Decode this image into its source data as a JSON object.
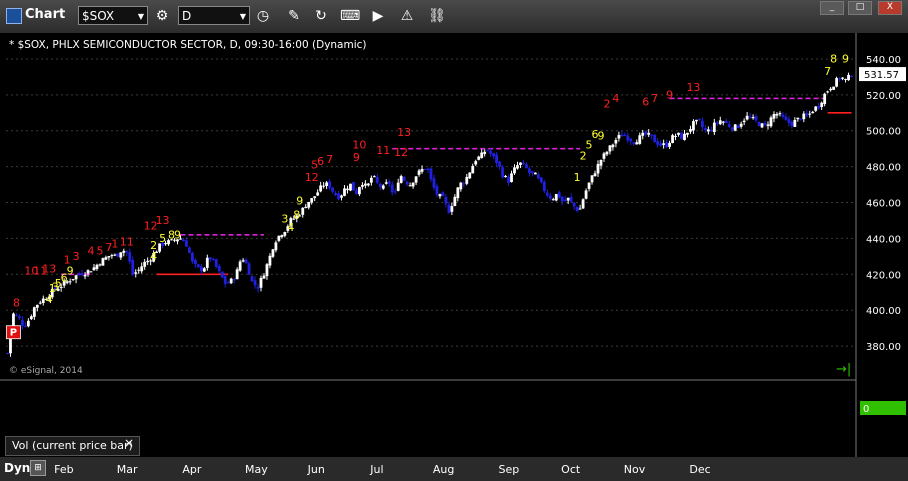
{
  "window": {
    "title": "Chart",
    "symbol": "$SOX",
    "interval": "D",
    "controls": [
      "_",
      "□",
      "X"
    ]
  },
  "chart_header": "* $SOX, PHLX SEMICONDUCTOR SECTOR, D, 09:30-16:00 (Dynamic)",
  "watermark": "© eSignal, 2014",
  "volume_pane": {
    "label": "Vol (current price bar)",
    "close": "×",
    "value_badge": "0"
  },
  "bottom_bar": {
    "mode": "Dyn"
  },
  "colors": {
    "up_candle": "#ffffff",
    "down_candle": "#2020e0",
    "setup_count": "#ffff33",
    "countdown": "#ff2020",
    "tdst_support": "#ff2020",
    "tdst_resistance": "#e020e0",
    "grid": "#3a3a3a",
    "last_price_badge": "#ffffff",
    "volume_badge": "#30c000"
  },
  "chart_data": {
    "type": "candlestick",
    "title": "* $SOX, PHLX SEMICONDUCTOR SECTOR, D, 09:30-16:00 (Dynamic)",
    "ylim": [
      365,
      550
    ],
    "y_ticks": [
      380,
      400,
      420,
      440,
      460,
      480,
      500,
      520,
      540
    ],
    "last_price": 531.57,
    "months": [
      "Feb",
      "Mar",
      "Apr",
      "May",
      "Jun",
      "Jul",
      "Aug",
      "Sep",
      "Oct",
      "Nov",
      "Dec"
    ],
    "closes": [
      376,
      398,
      396,
      391,
      395,
      402,
      405,
      407,
      410,
      412,
      414,
      416,
      418,
      420,
      421,
      422,
      424,
      427,
      429,
      431,
      430,
      434,
      432,
      420,
      422,
      426,
      428,
      432,
      436,
      438,
      438,
      440,
      440,
      436,
      426,
      423,
      423,
      430,
      426,
      420,
      415,
      416,
      420,
      430,
      425,
      415,
      413,
      420,
      428,
      438,
      442,
      445,
      450,
      452,
      455,
      460,
      462,
      466,
      470,
      470,
      465,
      463,
      468,
      470,
      465,
      472,
      468,
      475,
      470,
      468,
      472,
      462,
      476,
      472,
      470,
      475,
      478,
      480,
      470,
      464,
      462,
      455,
      462,
      470,
      472,
      478,
      484,
      486,
      490,
      486,
      482,
      475,
      472,
      478,
      482,
      480,
      476,
      475,
      470,
      465,
      462,
      465,
      460,
      462,
      458,
      455,
      465,
      472,
      478,
      484,
      488,
      492,
      496,
      498,
      496,
      494,
      496,
      498,
      497,
      494,
      492,
      492,
      496,
      498,
      496,
      500,
      504,
      505,
      500,
      500,
      504,
      506,
      504,
      502,
      502,
      506,
      508,
      506,
      504,
      502,
      506,
      510,
      508,
      505,
      504,
      506,
      508,
      508,
      512,
      514,
      520,
      524,
      527,
      530,
      528,
      531.57
    ],
    "tdst_lines": [
      {
        "type": "resistance",
        "value": 420,
        "from_bar": 18,
        "to_bar": 28
      },
      {
        "type": "support",
        "value": 420,
        "from_bar": 50,
        "to_bar": 74
      },
      {
        "type": "resistance",
        "value": 442,
        "from_bar": 58,
        "to_bar": 86
      },
      {
        "type": "resistance",
        "value": 490,
        "from_bar": 129,
        "to_bar": 192
      },
      {
        "type": "resistance",
        "value": 518,
        "from_bar": 222,
        "to_bar": 274
      },
      {
        "type": "support",
        "value": 510,
        "from_bar": 275,
        "to_bar": 283
      }
    ],
    "price_flip_marker": {
      "label": "P",
      "value": 388,
      "bar": 2
    },
    "annotations": [
      {
        "text": "8",
        "bar": 3,
        "value": 402,
        "color": "countdown"
      },
      {
        "text": "10",
        "bar": 8,
        "value": 420,
        "color": "countdown"
      },
      {
        "text": "11",
        "bar": 11,
        "value": 420,
        "color": "countdown"
      },
      {
        "text": "13",
        "bar": 14,
        "value": 421,
        "color": "countdown"
      },
      {
        "text": "1",
        "bar": 15,
        "value": 410,
        "color": "setup_count"
      },
      {
        "text": "3",
        "bar": 16,
        "value": 411,
        "color": "setup_count"
      },
      {
        "text": "5",
        "bar": 17,
        "value": 413,
        "color": "setup_count"
      },
      {
        "text": "6",
        "bar": 19,
        "value": 416,
        "color": "setup_count"
      },
      {
        "text": "9",
        "bar": 21,
        "value": 420,
        "color": "setup_count"
      },
      {
        "text": "4",
        "bar": 14,
        "value": 404,
        "color": "setup_count"
      },
      {
        "text": "1",
        "bar": 20,
        "value": 426,
        "color": "countdown"
      },
      {
        "text": "3",
        "bar": 23,
        "value": 428,
        "color": "countdown"
      },
      {
        "text": "4",
        "bar": 28,
        "value": 431,
        "color": "countdown"
      },
      {
        "text": "5",
        "bar": 31,
        "value": 431,
        "color": "countdown"
      },
      {
        "text": "7",
        "bar": 34,
        "value": 433,
        "color": "countdown"
      },
      {
        "text": "1",
        "bar": 36,
        "value": 435,
        "color": "countdown"
      },
      {
        "text": "11",
        "bar": 40,
        "value": 436,
        "color": "countdown"
      },
      {
        "text": "12",
        "bar": 48,
        "value": 445,
        "color": "countdown"
      },
      {
        "text": "13",
        "bar": 52,
        "value": 448,
        "color": "countdown"
      },
      {
        "text": "2",
        "bar": 49,
        "value": 434,
        "color": "setup_count"
      },
      {
        "text": "4",
        "bar": 49,
        "value": 428,
        "color": "setup_count"
      },
      {
        "text": "5",
        "bar": 52,
        "value": 438,
        "color": "setup_count"
      },
      {
        "text": "8",
        "bar": 55,
        "value": 440,
        "color": "setup_count"
      },
      {
        "text": "9",
        "bar": 57,
        "value": 440,
        "color": "setup_count"
      },
      {
        "text": "3",
        "bar": 93,
        "value": 449,
        "color": "setup_count"
      },
      {
        "text": "4",
        "bar": 95,
        "value": 444,
        "color": "setup_count"
      },
      {
        "text": "8",
        "bar": 97,
        "value": 451,
        "color": "setup_count"
      },
      {
        "text": "9",
        "bar": 98,
        "value": 459,
        "color": "setup_count"
      },
      {
        "text": "12",
        "bar": 102,
        "value": 472,
        "color": "countdown"
      },
      {
        "text": "5",
        "bar": 103,
        "value": 479,
        "color": "countdown"
      },
      {
        "text": "6",
        "bar": 105,
        "value": 481,
        "color": "countdown"
      },
      {
        "text": "7",
        "bar": 108,
        "value": 482,
        "color": "countdown"
      },
      {
        "text": "10",
        "bar": 118,
        "value": 490,
        "color": "countdown"
      },
      {
        "text": "9",
        "bar": 117,
        "value": 483,
        "color": "countdown"
      },
      {
        "text": "11",
        "bar": 126,
        "value": 487,
        "color": "countdown"
      },
      {
        "text": "12",
        "bar": 132,
        "value": 486,
        "color": "countdown"
      },
      {
        "text": "13",
        "bar": 133,
        "value": 497,
        "color": "countdown"
      },
      {
        "text": "1",
        "bar": 191,
        "value": 472,
        "color": "setup_count"
      },
      {
        "text": "2",
        "bar": 193,
        "value": 484,
        "color": "setup_count"
      },
      {
        "text": "5",
        "bar": 195,
        "value": 490,
        "color": "setup_count"
      },
      {
        "text": "6",
        "bar": 197,
        "value": 496,
        "color": "setup_count"
      },
      {
        "text": "9",
        "bar": 199,
        "value": 495,
        "color": "setup_count"
      },
      {
        "text": "2",
        "bar": 201,
        "value": 513,
        "color": "countdown"
      },
      {
        "text": "4",
        "bar": 204,
        "value": 516,
        "color": "countdown"
      },
      {
        "text": "6",
        "bar": 214,
        "value": 514,
        "color": "countdown"
      },
      {
        "text": "7",
        "bar": 217,
        "value": 516,
        "color": "countdown"
      },
      {
        "text": "9",
        "bar": 222,
        "value": 518,
        "color": "countdown"
      },
      {
        "text": "13",
        "bar": 230,
        "value": 522,
        "color": "countdown"
      },
      {
        "text": "7",
        "bar": 275,
        "value": 531,
        "color": "setup_count"
      },
      {
        "text": "8",
        "bar": 277,
        "value": 538,
        "color": "setup_count"
      },
      {
        "text": "9",
        "bar": 281,
        "value": 538,
        "color": "setup_count"
      }
    ]
  }
}
